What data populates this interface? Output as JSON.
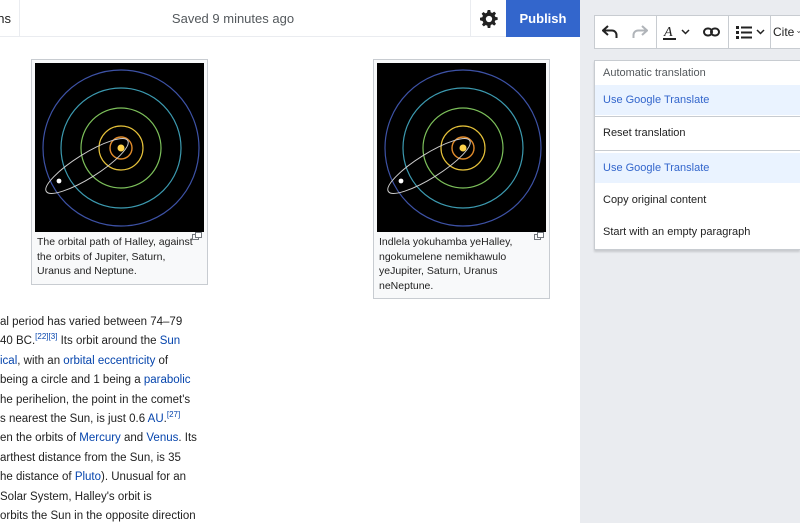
{
  "topbar": {
    "left_fragment": "ns",
    "saved_status": "Saved 9 minutes ago",
    "publish_label": "Publish"
  },
  "figures": [
    {
      "caption": "The orbital path of Halley, against the orbits of Jupiter, Saturn, Uranus and Neptune."
    },
    {
      "caption": "Indlela yokuhamba yeHalley, ngokumelene nemikhawulo yeJupiter, Saturn, Uranus neNeptune."
    }
  ],
  "article": {
    "l1": "al period has varied between 74–79",
    "l2_a": "40 BC.",
    "l2_ref1": "[22]",
    "l2_ref2": "[3]",
    "l2_b": " Its orbit around the ",
    "l2_link": "Sun",
    "l3_link1": "ical",
    "l3_a": ", with an ",
    "l3_link2": "orbital eccentricity",
    "l3_b": " of",
    "l4_a": "being a circle and 1 being a ",
    "l4_link": "parabolic",
    "l5": "he perihelion, the point in the comet's",
    "l6_a": "s nearest the Sun, is just 0.6 ",
    "l6_link": "AU",
    "l6_b": ".",
    "l6_ref": "[27]",
    "l7_a": "en the orbits of ",
    "l7_link1": "Mercury",
    "l7_b": " and ",
    "l7_link2": "Venus",
    "l7_c": ". Its",
    "l8": "arthest distance from the Sun, is 35",
    "l9_a": "he distance of ",
    "l9_link": "Pluto",
    "l9_b": "). Unusual for an",
    "l10": "Solar System, Halley's orbit is",
    "l11": "orbits the Sun in the opposite direction"
  },
  "toolbar": {
    "undo_icon": "undo-icon",
    "redo_icon": "redo-icon",
    "text_style_icon": "text-style-icon",
    "link_icon": "link-icon",
    "list_icon": "list-icon",
    "cite_label": "Cite"
  },
  "menu": {
    "header": "Automatic translation",
    "selected": "Use Google Translate",
    "items": [
      "Reset translation",
      "Use Google Translate",
      "Copy original content",
      "Start with an empty paragraph"
    ]
  },
  "colors": {
    "accent": "#3366cc",
    "link": "#0645ad",
    "highlight_bg": "#eaf3ff",
    "panel_bg": "#eaecf0",
    "border": "#c8ccd1"
  }
}
